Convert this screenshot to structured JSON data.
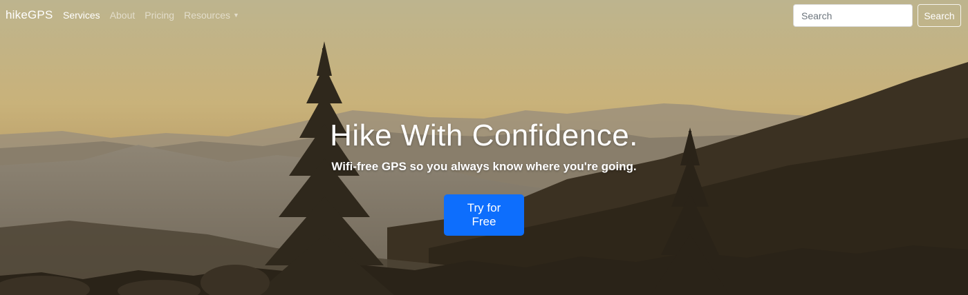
{
  "navbar": {
    "brand": "hikeGPS",
    "links": [
      {
        "label": "Services",
        "active": true
      },
      {
        "label": "About",
        "active": false
      },
      {
        "label": "Pricing",
        "active": false
      },
      {
        "label": "Resources",
        "active": false,
        "dropdown": true
      }
    ],
    "search": {
      "placeholder": "Search",
      "button_label": "Search"
    }
  },
  "hero": {
    "title": "Hike With Confidence.",
    "subtitle": "Wifi-free GPS so you always know where you're going.",
    "cta_label": "Try for Free"
  },
  "colors": {
    "primary": "#0d6efd",
    "sky": "#c8b27a",
    "foreground": "#2e2619"
  },
  "icons": {
    "dropdown": "chevron-down-icon"
  }
}
